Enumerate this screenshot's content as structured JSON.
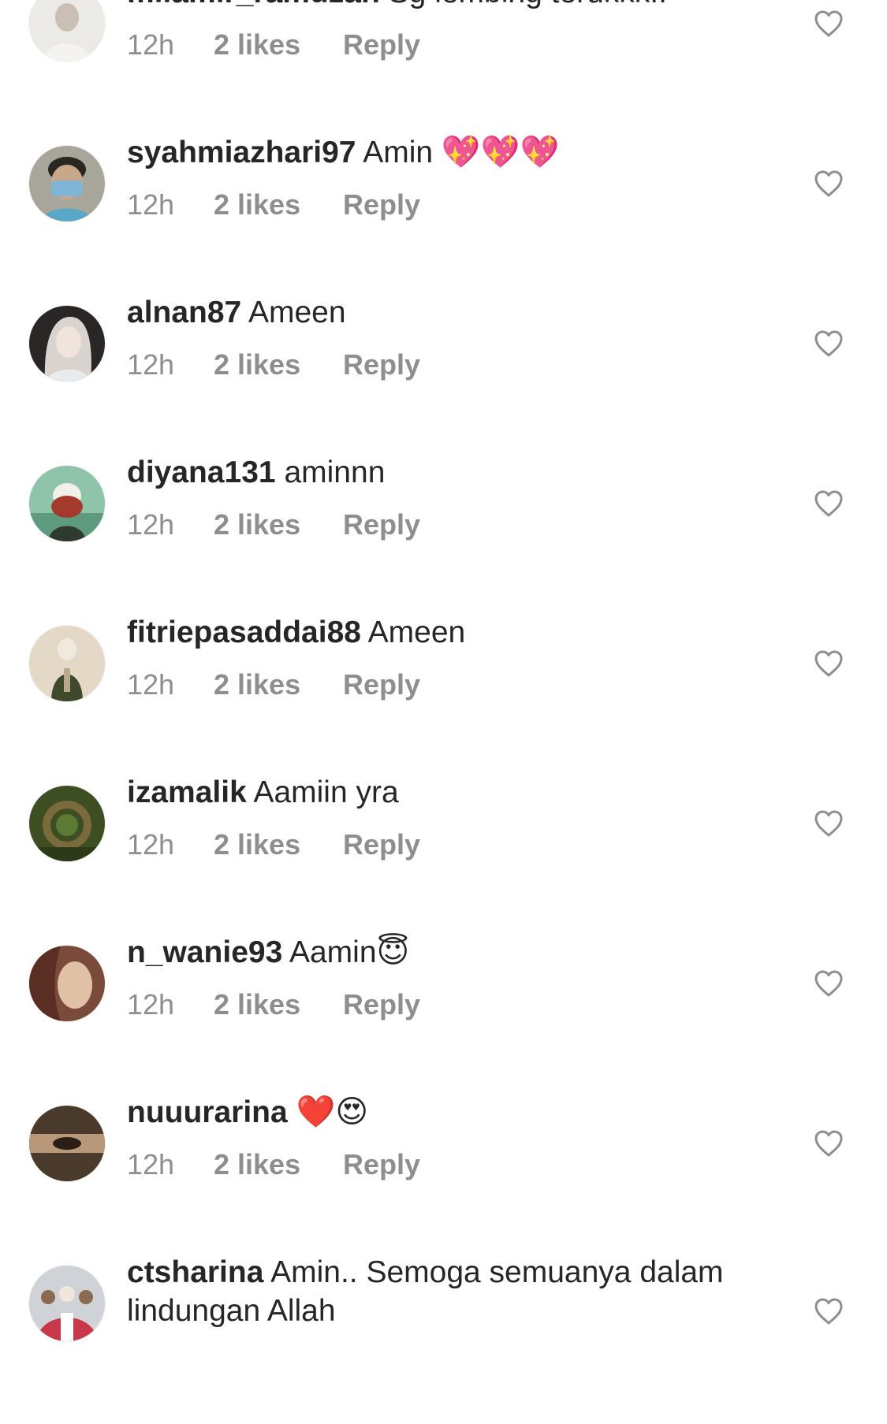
{
  "comments": [
    {
      "username": "milamir_ramdzan",
      "text": "Sg lembing terukkk..",
      "emoji": "",
      "time": "12h",
      "likes": "2 likes",
      "reply": "Reply",
      "avatar_color": "#e8e6e3",
      "avatar_accent": "#c9bfb5"
    },
    {
      "username": "syahmiazhari97",
      "text": "Amin",
      "emoji": "💖💖💖",
      "time": "12h",
      "likes": "2 likes",
      "reply": "Reply",
      "avatar_color": "#9c9a8c",
      "avatar_accent": "#7fb6d8"
    },
    {
      "username": "alnan87",
      "text": "Ameen",
      "emoji": "",
      "time": "12h",
      "likes": "2 likes",
      "reply": "Reply",
      "avatar_color": "#2b2626",
      "avatar_accent": "#f1e4dc"
    },
    {
      "username": "diyana131",
      "text": "aminnn",
      "emoji": "",
      "time": "12h",
      "likes": "2 likes",
      "reply": "Reply",
      "avatar_color": "#7fb89c",
      "avatar_accent": "#3a5a4a"
    },
    {
      "username": "fitriepasaddai88",
      "text": "Ameen",
      "emoji": "",
      "time": "12h",
      "likes": "2 likes",
      "reply": "Reply",
      "avatar_color": "#d8cbb7",
      "avatar_accent": "#3f4a2c"
    },
    {
      "username": "izamalik",
      "text": "Aamiin yra",
      "emoji": "",
      "time": "12h",
      "likes": "2 likes",
      "reply": "Reply",
      "avatar_color": "#3d4f22",
      "avatar_accent": "#7a6a3c"
    },
    {
      "username": "n_wanie93",
      "text": "Aamin",
      "emoji": "😇",
      "time": "12h",
      "likes": "2 likes",
      "reply": "Reply",
      "avatar_color": "#8a5a48",
      "avatar_accent": "#e0c1a6"
    },
    {
      "username": "nuuurarina",
      "text": "",
      "emoji": "❤️😍",
      "time": "12h",
      "likes": "2 likes",
      "reply": "Reply",
      "avatar_color": "#4a3a2c",
      "avatar_accent": "#b89878"
    },
    {
      "username": "ctsharina",
      "text": "Amin.. Semoga semuanya dalam lindungan Allah",
      "emoji": "",
      "time": "",
      "likes": "",
      "reply": "",
      "avatar_color": "#cfd2d6",
      "avatar_accent": "#c8374a"
    }
  ],
  "colors": {
    "text": "#262626",
    "secondary": "#8e8e8e",
    "heart_outline": "#8e8e8e",
    "background": "#ffffff"
  },
  "icons": {
    "like": "heart-outline-icon"
  }
}
